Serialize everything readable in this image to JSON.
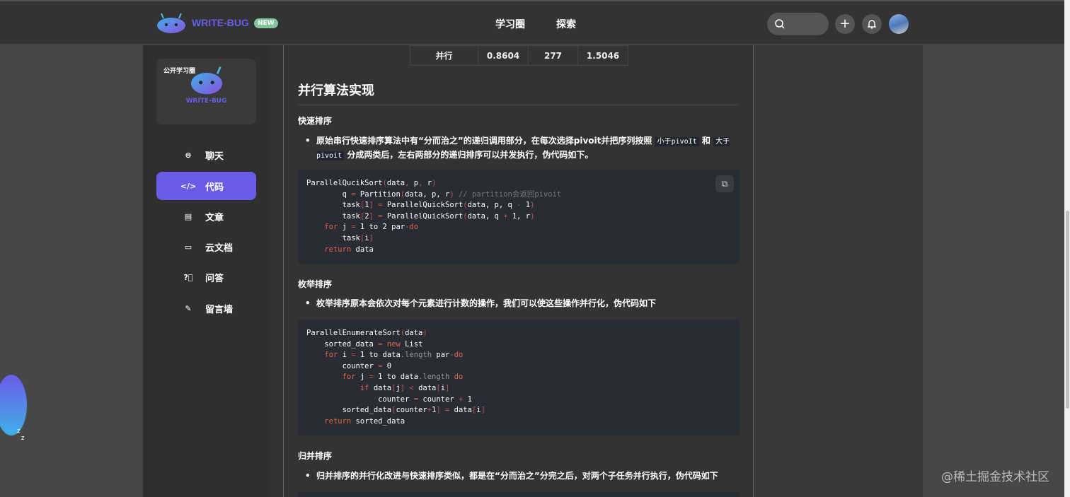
{
  "header": {
    "brand": "WRITE-BUG",
    "badge": "NEW",
    "nav": [
      "学习圈",
      "探索"
    ]
  },
  "sidebar": {
    "card_tag": "公开学习圈",
    "card_name": "WRITE-BUG",
    "items": [
      {
        "label": "聊天",
        "icon": "chat-icon"
      },
      {
        "label": "代码",
        "icon": "code-icon",
        "active": true
      },
      {
        "label": "文章",
        "icon": "article-icon"
      },
      {
        "label": "云文档",
        "icon": "folder-icon"
      },
      {
        "label": "问答",
        "icon": "question-icon"
      },
      {
        "label": "留言墙",
        "icon": "edit-icon"
      }
    ]
  },
  "table_row": [
    "并行",
    "0.8604",
    "277",
    "1.5046"
  ],
  "article": {
    "h2": "并行算法实现",
    "s1": {
      "title": "快速排序",
      "b1": "原始串行快速排序算法中有“分而治之”的递归调用部分，在每次选择pivoit并把序列按照",
      "c1": "小于pivoIt",
      "m": "和",
      "c2": "大于pivoit",
      "b2": "分成两类后，左右两部分的递归排序可以并发执行，伪代码如下。"
    },
    "code1": [
      [
        [
          "ParallelQucikSort",
          ""
        ],
        [
          "(",
          "p"
        ],
        [
          "data",
          ""
        ],
        [
          ", ",
          "p"
        ],
        [
          "p",
          ""
        ],
        [
          ", ",
          "p"
        ],
        [
          "r",
          ""
        ],
        [
          ")",
          "p"
        ]
      ],
      [
        [
          "        q ",
          ""
        ],
        [
          "=",
          "p"
        ],
        [
          " Partition",
          ""
        ],
        [
          "(",
          "p"
        ],
        [
          "data, p, r",
          ""
        ],
        [
          ")",
          "p"
        ],
        [
          " // partition会返回pivoit",
          "c"
        ]
      ],
      [
        [
          "        task",
          ""
        ],
        [
          "[",
          "p"
        ],
        [
          "1",
          ""
        ],
        [
          "]",
          "p"
        ],
        [
          " = ",
          "p"
        ],
        [
          "ParallelQuickSort",
          ""
        ],
        [
          "(",
          "p"
        ],
        [
          "data, p, q ",
          ""
        ],
        [
          "-",
          "p"
        ],
        [
          " 1",
          ""
        ],
        [
          ")",
          "p"
        ]
      ],
      [
        [
          "        task",
          ""
        ],
        [
          "[",
          "p"
        ],
        [
          "2",
          ""
        ],
        [
          "]",
          "p"
        ],
        [
          " = ",
          "p"
        ],
        [
          "ParallelQuickSort",
          ""
        ],
        [
          "(",
          "p"
        ],
        [
          "data, q ",
          ""
        ],
        [
          "+",
          "p"
        ],
        [
          " 1, r",
          ""
        ],
        [
          ")",
          "p"
        ]
      ],
      [
        [
          "    ",
          ""
        ],
        [
          "for",
          "k"
        ],
        [
          " j ",
          ""
        ],
        [
          "=",
          "p"
        ],
        [
          " 1 to 2 par",
          ""
        ],
        [
          "-do",
          "k"
        ]
      ],
      [
        [
          "        task",
          ""
        ],
        [
          "[",
          "p"
        ],
        [
          "i",
          ""
        ],
        [
          "]",
          "p"
        ]
      ],
      [
        [
          "    ",
          ""
        ],
        [
          "return",
          "k"
        ],
        [
          " data",
          ""
        ]
      ]
    ],
    "s2": {
      "title": "枚举排序",
      "b1": "枚举排序原本会依次对每个元素进行计数的操作，我们可以使这些操作并行化，伪代码如下"
    },
    "code2": [
      [
        [
          "ParallelEnumerateSort",
          ""
        ],
        [
          "(",
          "p"
        ],
        [
          "data",
          ""
        ],
        [
          ")",
          "p"
        ]
      ],
      [
        [
          "    sorted_data ",
          ""
        ],
        [
          "=",
          "p"
        ],
        [
          " new",
          "k"
        ],
        [
          " List",
          ""
        ]
      ],
      [
        [
          "    ",
          ""
        ],
        [
          "for",
          "k"
        ],
        [
          " i ",
          ""
        ],
        [
          "=",
          "p"
        ],
        [
          " 1 to data",
          ""
        ],
        [
          ".length",
          "g"
        ],
        [
          " par",
          ""
        ],
        [
          "-do",
          "k"
        ]
      ],
      [
        [
          "        counter ",
          ""
        ],
        [
          "=",
          "p"
        ],
        [
          " 0",
          ""
        ]
      ],
      [
        [
          "        ",
          ""
        ],
        [
          "for",
          "k"
        ],
        [
          " j ",
          ""
        ],
        [
          "=",
          "p"
        ],
        [
          " 1 to data",
          ""
        ],
        [
          ".length",
          "g"
        ],
        [
          " do",
          "k"
        ]
      ],
      [
        [
          "            ",
          ""
        ],
        [
          "if",
          "k"
        ],
        [
          " data",
          ""
        ],
        [
          "[",
          "p"
        ],
        [
          "j",
          ""
        ],
        [
          "]",
          "p"
        ],
        [
          " < ",
          "p"
        ],
        [
          "data",
          ""
        ],
        [
          "[",
          "p"
        ],
        [
          "i",
          ""
        ],
        [
          "]",
          "p"
        ]
      ],
      [
        [
          "                counter ",
          ""
        ],
        [
          "=",
          "p"
        ],
        [
          " counter ",
          ""
        ],
        [
          "+",
          "p"
        ],
        [
          " 1",
          ""
        ]
      ],
      [
        [
          "        sorted_data",
          ""
        ],
        [
          "[",
          "p"
        ],
        [
          "counter",
          ""
        ],
        [
          "+",
          "p"
        ],
        [
          "1",
          ""
        ],
        [
          "]",
          "p"
        ],
        [
          " = ",
          "p"
        ],
        [
          "data",
          ""
        ],
        [
          "[",
          "p"
        ],
        [
          "i",
          ""
        ],
        [
          "]",
          "p"
        ]
      ],
      [
        [
          "    ",
          ""
        ],
        [
          "return",
          "k"
        ],
        [
          " sorted_data",
          ""
        ]
      ]
    ],
    "s3": {
      "title": "归并排序",
      "b1": "归并排序的并行化改进与快速排序类似，都是在“分而治之”分完之后，对两个子任务并行执行，伪代码如下"
    }
  },
  "watermark": "@稀土掘金技术社区"
}
